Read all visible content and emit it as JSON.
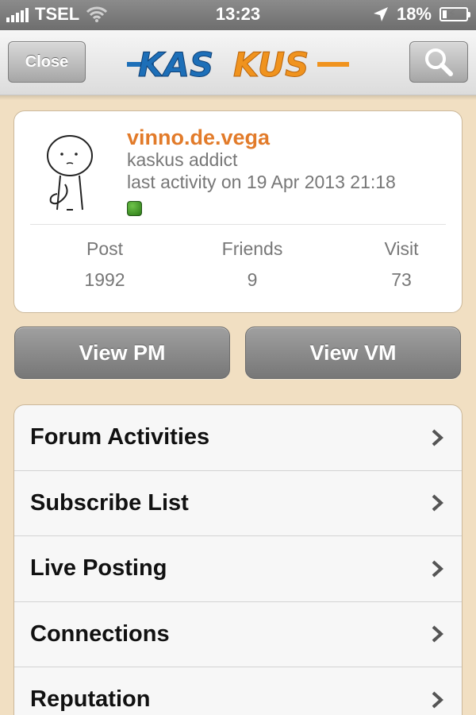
{
  "status_bar": {
    "carrier": "TSEL",
    "time": "13:23",
    "battery": "18%",
    "battery_level": 0.18,
    "icons": [
      "signal-bars-icon",
      "wifi-icon",
      "location-arrow-icon",
      "battery-charging-icon"
    ]
  },
  "nav": {
    "close_label": "Close",
    "logo_text": "KASKUS",
    "search_icon": "search-icon"
  },
  "colors": {
    "background": "#f1dfc2",
    "username": "#e27b2a",
    "logo_blue": "#1d6fb8",
    "logo_orange": "#f0931e",
    "status_online": "#3d9a22"
  },
  "profile": {
    "username": "vinno.de.vega",
    "rank": "kaskus addict",
    "last_activity": "last activity on 19 Apr 2013 21:18",
    "online": true,
    "stats": [
      {
        "label": "Post",
        "value": "1992"
      },
      {
        "label": "Friends",
        "value": "9"
      },
      {
        "label": "Visit",
        "value": "73"
      }
    ]
  },
  "actions": {
    "view_pm": "View PM",
    "view_vm": "View VM"
  },
  "menu": [
    {
      "label": "Forum Activities"
    },
    {
      "label": "Subscribe List"
    },
    {
      "label": "Live Posting"
    },
    {
      "label": "Connections"
    },
    {
      "label": "Reputation"
    }
  ]
}
